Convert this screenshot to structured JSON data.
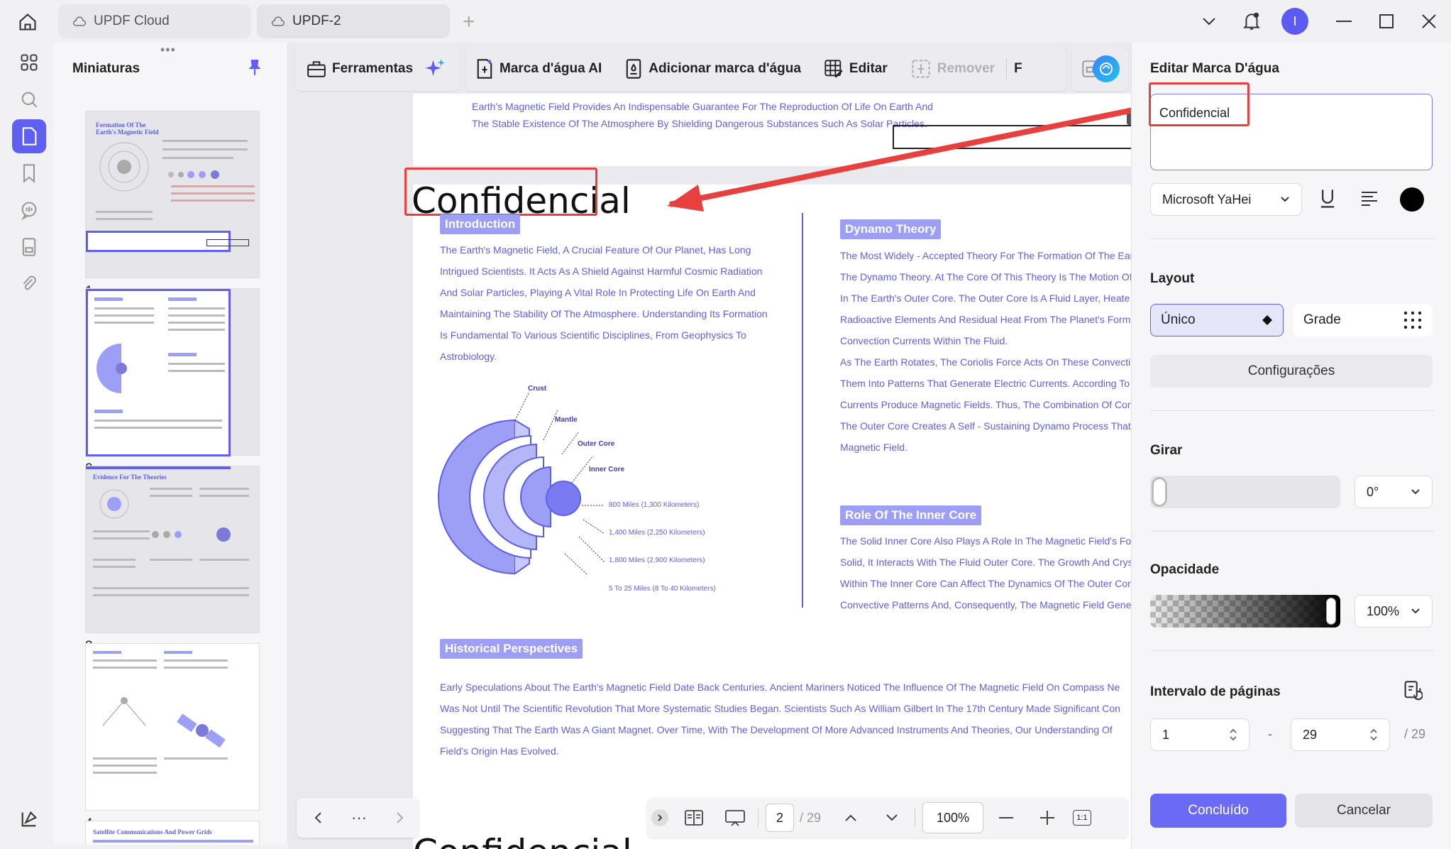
{
  "tabs": [
    {
      "label": "UPDF Cloud",
      "icon": "cloud-icon"
    },
    {
      "label": "UPDF-2",
      "icon": "cloud-icon"
    }
  ],
  "user": {
    "avatar_letter": "I"
  },
  "thumbnails": {
    "title": "Miniaturas",
    "pages": [
      {
        "num": "1",
        "heading": "Formation Of The Earth's Magnetic Field"
      },
      {
        "num": "2",
        "heading": ""
      },
      {
        "num": "3",
        "heading": "Evidence For The Theories"
      },
      {
        "num": "4",
        "heading": ""
      },
      {
        "num": "",
        "heading": "Satellite Communications And Power Grids"
      }
    ]
  },
  "toolbar": {
    "tools_label": "Ferramentas",
    "ai_watermark": "Marca d'água AI",
    "add_watermark": "Adicionar marca d'água",
    "edit": "Editar",
    "remove": "Remover",
    "overflow": "F"
  },
  "document": {
    "top_lines": [
      "Earth's Magnetic Field Provides An Indispensable Guarantee For The Reproduction Of Life On Earth And",
      "The Stable Existence Of The Atmosphere By Shielding Dangerous Substances Such As Solar Particles."
    ],
    "watermark_text": "Confidencial",
    "intro": {
      "title": "Introduction",
      "lines": [
        "The Earth's Magnetic Field, A Crucial Feature Of Our Planet, Has Long",
        "Intrigued Scientists. It Acts As A Shield Against Harmful Cosmic Radiation",
        "And Solar Particles, Playing A Vital Role In Protecting Life On Earth And",
        "Maintaining The Stability Of The Atmosphere. Understanding Its Formation",
        "Is Fundamental To Various Scientific Disciplines, From Geophysics To",
        "Astrobiology."
      ]
    },
    "diagram": {
      "labels": [
        "Crust",
        "Mantle",
        "Outer Core",
        "Inner Core"
      ],
      "distances": [
        "800 Miles (1,300 Kilometers)",
        "1,400 Miles (2,250 Kilometers)",
        "1,800 Miles (2,900 Kilometers)",
        "5 To 25 Miles (8 To 40 Kilometers)"
      ]
    },
    "dynamo": {
      "title": "Dynamo Theory",
      "lines": [
        "The Most Widely - Accepted Theory For The Formation Of The Ear",
        "The Dynamo Theory. At The Core Of This Theory Is The Motion Of",
        "In The Earth's Outer Core. The Outer Core Is A Fluid Layer, Heate",
        "Radioactive Elements And Residual Heat From The Planet's Forma",
        "Convection Currents Within The Fluid.",
        "As The Earth Rotates, The Coriolis Force Acts On These Convecti",
        "Them Into Patterns That Generate Electric Currents. According To",
        "Currents Produce Magnetic Fields. Thus, The Combination Of Con",
        "The Outer Core Creates A Self - Sustaining Dynamo Process That",
        "Magnetic Field."
      ]
    },
    "inner_core": {
      "title": "Role Of The Inner Core",
      "lines": [
        "The Solid Inner Core Also Plays A Role In The Magnetic Field's Fo",
        "Solid, It Interacts With The Fluid Outer Core. The Growth And Crys",
        "Within The Inner Core Can Affect The Dynamics Of The Outer Cor",
        "Convective Patterns And, Consequently, The Magnetic Field Gene"
      ]
    },
    "historical": {
      "title": "Historical Perspectives",
      "lines": [
        "Early Speculations About The Earth's Magnetic Field Date Back Centuries. Ancient Mariners Noticed The Influence Of The Magnetic Field On Compass Ne",
        "Was Not Until The Scientific Revolution That More Systematic Studies Began. Scientists Such As William Gilbert In The 17th Century Made Significant Con",
        "Suggesting That The Earth Was A Giant Magnet. Over Time, With The Development Of More Advanced Instruments And Theories, Our Understanding Of",
        "Field's Origin Has Evolved."
      ]
    }
  },
  "pager": {
    "current_page": "2",
    "total": "/ 29",
    "zoom": "100%",
    "fit_label": "1:1"
  },
  "panel": {
    "title": "Editar Marca D'água",
    "text_value": "Confidencial",
    "font": "Microsoft YaHei",
    "color": "#000000",
    "layout_label": "Layout",
    "layout_single": "Único",
    "layout_grid": "Grade",
    "settings": "Configurações",
    "rotate_label": "Girar",
    "rotate_value": "0°",
    "rotation_level": 0,
    "opacity_label": "Opacidade",
    "opacity_value": "100%",
    "opacity_level": 1.0,
    "range_label": "Intervalo de páginas",
    "range_from": "1",
    "range_dash": "-",
    "range_to": "29",
    "range_total": "/ 29",
    "done": "Concluído",
    "cancel": "Cancelar"
  },
  "colors": {
    "accent": "#5f5ff2",
    "doc_text": "#5e5ee8",
    "section_bg": "#9d9ef5",
    "highlight_red": "#e8403f"
  }
}
